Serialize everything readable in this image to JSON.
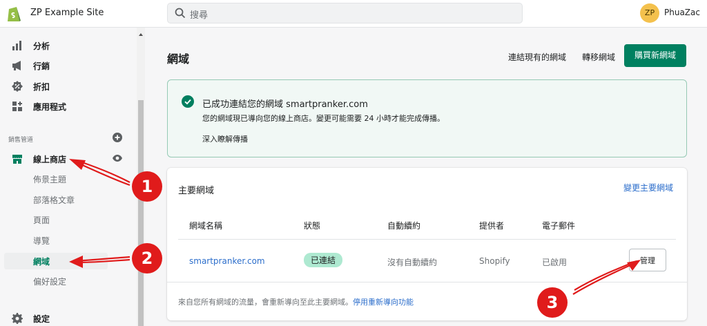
{
  "topbar": {
    "site_name": "ZP Example Site",
    "search_placeholder": "搜尋",
    "avatar_initials": "ZP",
    "user_name": "PhuaZac"
  },
  "sidebar": {
    "items": [
      {
        "label": "分析",
        "icon": "bar-chart-icon"
      },
      {
        "label": "行銷",
        "icon": "megaphone-icon"
      },
      {
        "label": "折扣",
        "icon": "discount-icon"
      },
      {
        "label": "應用程式",
        "icon": "apps-icon"
      }
    ],
    "section_title": "銷售管道",
    "channel": {
      "label": "線上商店",
      "icon": "store-icon"
    },
    "sub_items": [
      "佈景主題",
      "部落格文章",
      "頁面",
      "導覽",
      "網域",
      "偏好設定"
    ],
    "active_sub": "網域",
    "settings": {
      "label": "設定",
      "icon": "gear-icon"
    }
  },
  "page": {
    "title": "網域",
    "connect_link": "連結現有的網域",
    "transfer_link": "轉移網域",
    "buy_button": "購買新網域"
  },
  "banner": {
    "title": "已成功連結您的網域 smartpranker.com",
    "text": "您的網域現已導向您的線上商店。變更可能需要 24 小時才能完成傳播。",
    "link": "深入瞭解傳播"
  },
  "card": {
    "title": "主要網域",
    "change_link": "變更主要網域",
    "headers": [
      "網域名稱",
      "狀態",
      "自動續約",
      "提供者",
      "電子郵件"
    ],
    "row": {
      "domain": "smartpranker.com",
      "status": "已連結",
      "renewal": "沒有自動續約",
      "provider": "Shopify",
      "email": "已啟用",
      "action": "管理"
    },
    "footer_text": "來自您所有網域的流量，會重新導向至此主要網域。",
    "footer_link": "停用重新導向功能"
  },
  "annotations": [
    "1",
    "2",
    "3"
  ],
  "colors": {
    "primary": "#008060",
    "link": "#2c6ecb",
    "badge": "#aee9d1",
    "banner_bg": "#f1f8f5",
    "annotation": "#e01b1b"
  }
}
